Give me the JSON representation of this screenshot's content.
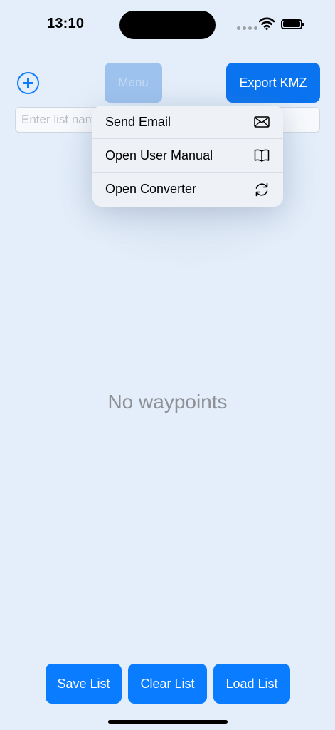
{
  "status_bar": {
    "time": "13:10"
  },
  "toolbar": {
    "add_icon": "plus-circle-icon",
    "menu_label": "Menu",
    "export_label": "Export KMZ"
  },
  "list_name": {
    "placeholder": "Enter list name",
    "value": ""
  },
  "menu_popup": {
    "items": [
      {
        "label": "Send Email",
        "icon": "envelope-icon"
      },
      {
        "label": "Open User Manual",
        "icon": "book-icon"
      },
      {
        "label": "Open Converter",
        "icon": "refresh-icon"
      }
    ]
  },
  "main": {
    "empty_message": "No waypoints"
  },
  "bottom_actions": {
    "save_label": "Save List",
    "clear_label": "Clear List",
    "load_label": "Load List"
  },
  "colors": {
    "accent": "#0a7cff",
    "background": "#e4eefa",
    "muted_text": "#8d9095"
  }
}
